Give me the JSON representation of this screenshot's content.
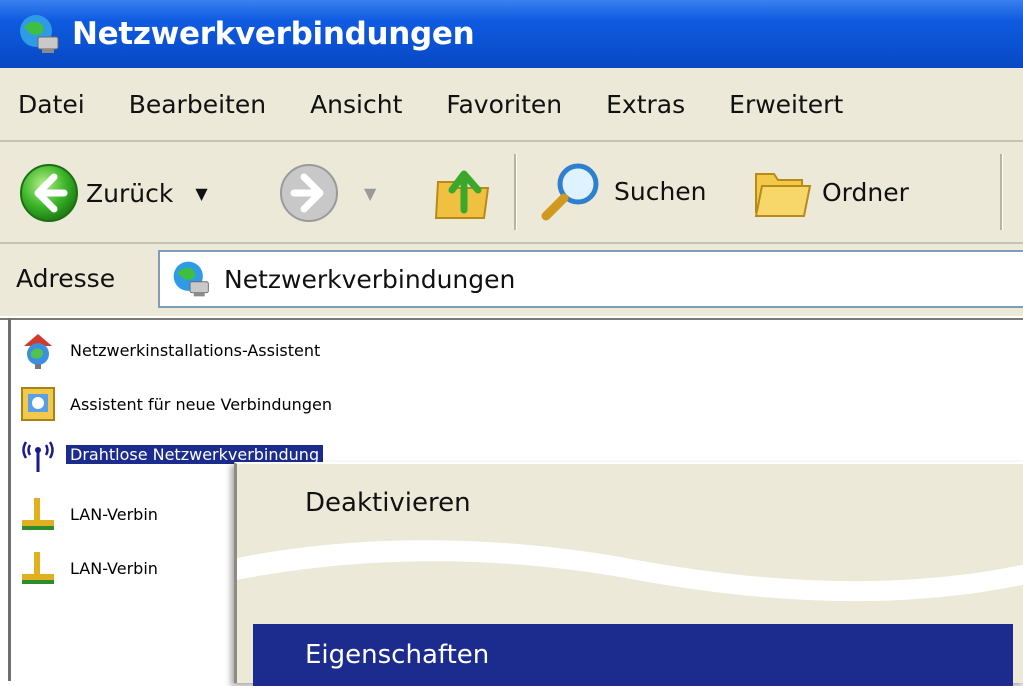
{
  "window": {
    "title": "Netzwerkverbindungen"
  },
  "menu": {
    "items": [
      "Datei",
      "Bearbeiten",
      "Ansicht",
      "Favoriten",
      "Extras",
      "Erweitert"
    ]
  },
  "toolbar": {
    "back_label": "Zurück",
    "search_label": "Suchen",
    "folders_label": "Ordner"
  },
  "address": {
    "label": "Adresse",
    "value": "Netzwerkverbindungen"
  },
  "items": [
    {
      "label": "Netzwerkinstallations-Assistent",
      "icon": "network-setup-wizard-icon"
    },
    {
      "label": "Assistent für neue Verbindungen",
      "icon": "new-connection-wizard-icon"
    },
    {
      "label": "Drahtlose Netzwerkverbindung",
      "icon": "wireless-network-icon",
      "selected": true
    },
    {
      "label": "LAN-Verbin",
      "icon": "lan-connection-icon"
    },
    {
      "label": "LAN-Verbin",
      "icon": "lan-connection-icon"
    }
  ],
  "context_menu": {
    "items": [
      "Deaktivieren",
      "Eigenschaften"
    ],
    "highlighted": "Eigenschaften"
  },
  "colors": {
    "titlebar": "#0a4fcf",
    "chrome": "#ece9d8",
    "selection": "#1c2c8e"
  }
}
